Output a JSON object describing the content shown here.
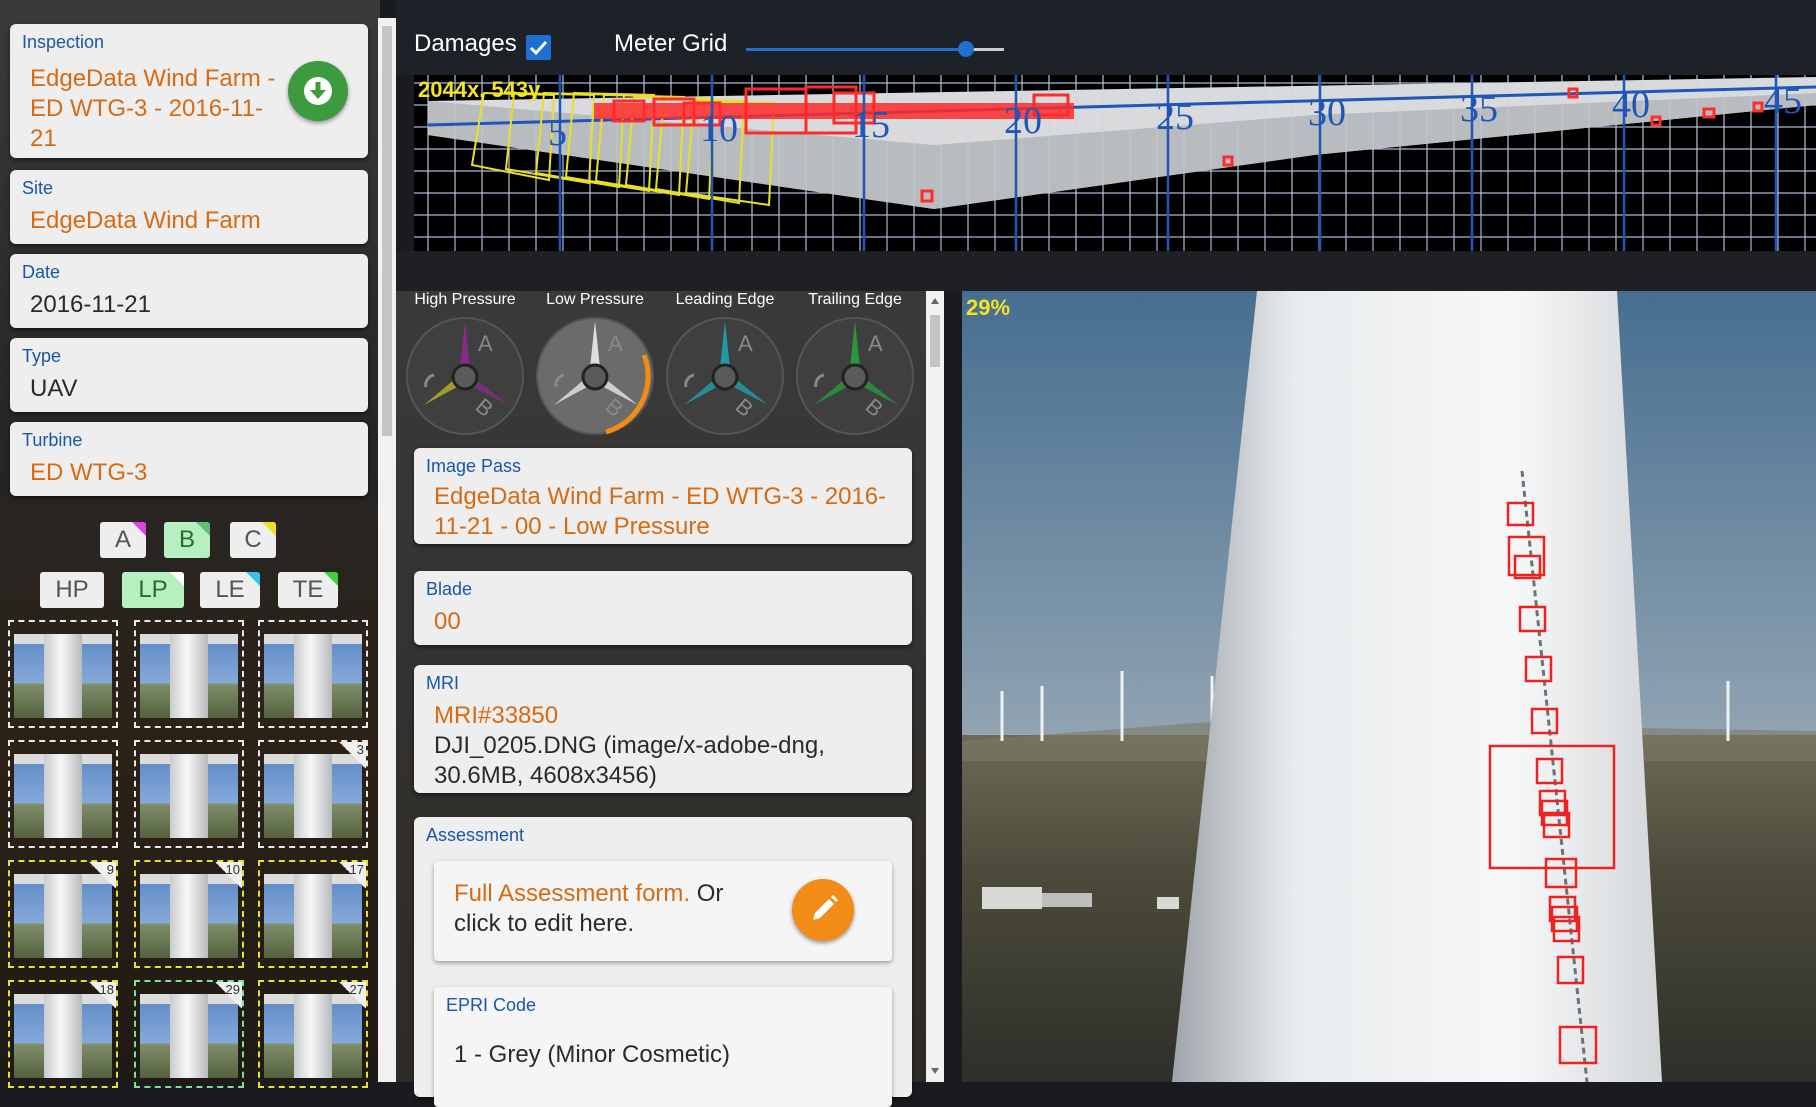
{
  "inspection_panel": {
    "inspection": {
      "label": "Inspection",
      "value_lines": [
        "EdgeData Wind Farm -",
        "ED WTG-3 - 2016-11-",
        "21"
      ]
    },
    "site": {
      "label": "Site",
      "value": "EdgeData Wind Farm"
    },
    "date": {
      "label": "Date",
      "value": "2016-11-21"
    },
    "type": {
      "label": "Type",
      "value": "UAV"
    },
    "turbine": {
      "label": "Turbine",
      "value": "ED WTG-3"
    },
    "download_icon": "download-icon"
  },
  "blade_filters": [
    {
      "label": "A",
      "selected": false,
      "corner": "#e040e0"
    },
    {
      "label": "B",
      "selected": true,
      "corner": "#60c070"
    },
    {
      "label": "C",
      "selected": false,
      "corner": "#f0e020"
    }
  ],
  "side_filters": [
    {
      "label": "HP",
      "selected": false,
      "corner": null
    },
    {
      "label": "LP",
      "selected": true,
      "corner": "#ffffff"
    },
    {
      "label": "LE",
      "selected": false,
      "corner": "#30c8e0"
    },
    {
      "label": "TE",
      "selected": false,
      "corner": "#40d040"
    }
  ],
  "thumbnails": [
    {
      "num": "",
      "border": "white"
    },
    {
      "num": "",
      "border": "white"
    },
    {
      "num": "",
      "border": "white"
    },
    {
      "num": "",
      "border": "white"
    },
    {
      "num": "",
      "border": "white"
    },
    {
      "num": "3",
      "border": "white"
    },
    {
      "num": "9",
      "border": "yellow"
    },
    {
      "num": "10",
      "border": "yellow"
    },
    {
      "num": "17",
      "border": "yellow"
    },
    {
      "num": "18",
      "border": "yellow"
    },
    {
      "num": "29",
      "border": "green"
    },
    {
      "num": "27",
      "border": "yellow"
    }
  ],
  "toolbar": {
    "damages_label": "Damages",
    "damages_checked": true,
    "meter_grid_label": "Meter Grid",
    "meter_grid_level": 0.75
  },
  "blade_map": {
    "coord_readout": "2044x, 543y",
    "ticks": [
      "5",
      "10",
      "15",
      "20",
      "25",
      "30",
      "35",
      "40",
      "45"
    ]
  },
  "view_dials": [
    {
      "label": "High Pressure",
      "color": "#8a2a8a",
      "selected": false
    },
    {
      "label": "Low Pressure",
      "color": "#e6e6e6",
      "selected": true
    },
    {
      "label": "Leading Edge",
      "color": "#1fa0a8",
      "selected": false
    },
    {
      "label": "Trailing Edge",
      "color": "#2a9a3a",
      "selected": false
    }
  ],
  "image_pass": {
    "label": "Image Pass",
    "value_lines": [
      "EdgeData Wind Farm - ED WTG-3 - 2016-",
      "11-21 - 00 - Low Pressure"
    ]
  },
  "blade": {
    "label": "Blade",
    "value": "00"
  },
  "mri": {
    "label": "MRI",
    "link": "MRI#33850",
    "detail_lines": [
      "DJI_0205.DNG (image/x-adobe-dng,",
      "30.6MB, 4608x3456)"
    ]
  },
  "assessment": {
    "label": "Assessment",
    "link": "Full Assessment form.",
    "text_after": " Or",
    "text_line2": "click to edit here.",
    "edit_icon": "pencil-icon"
  },
  "epri_code": {
    "label": "EPRI Code",
    "value": "1 - Grey (Minor Cosmetic)"
  },
  "photo": {
    "zoom_readout": "29%"
  }
}
